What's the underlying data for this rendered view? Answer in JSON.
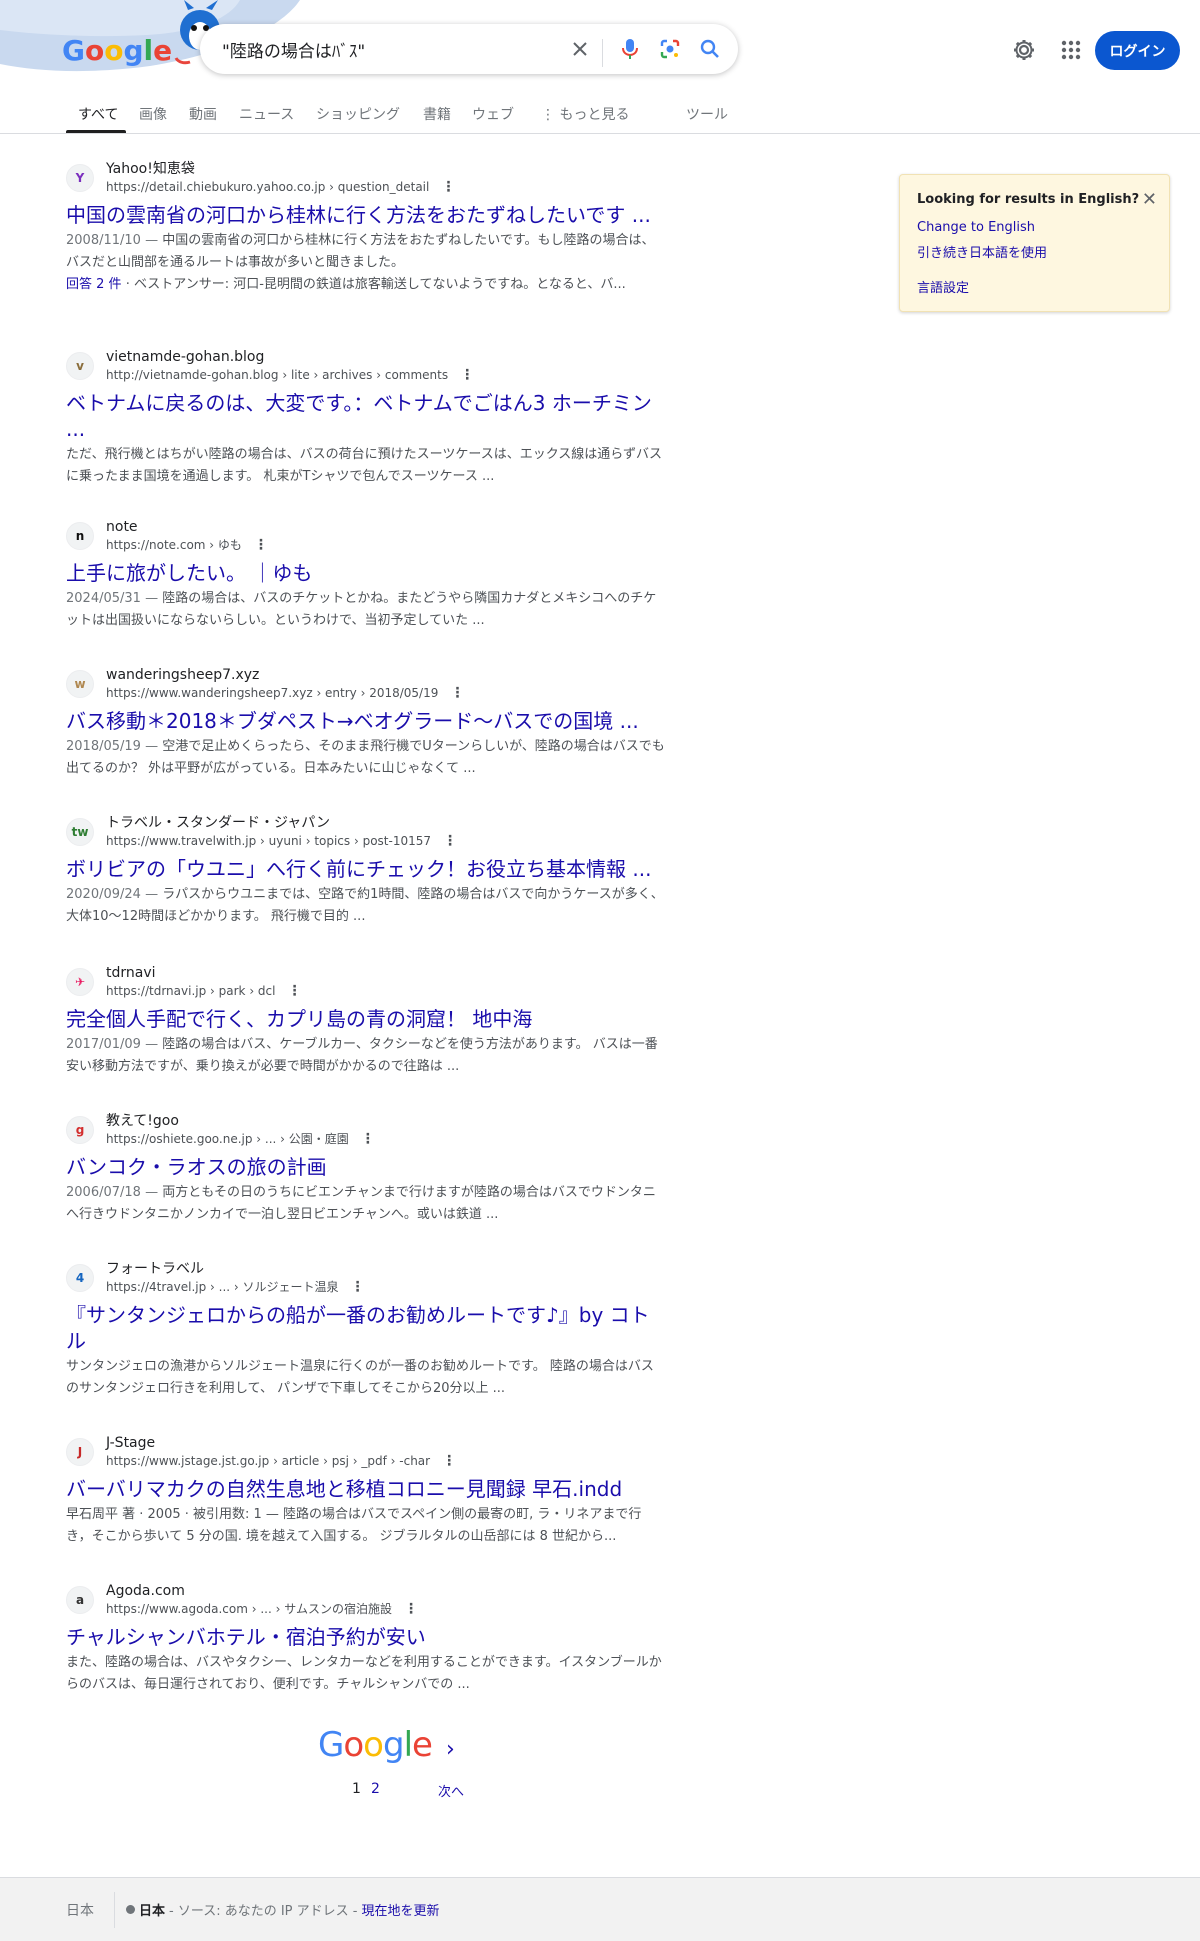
{
  "search": {
    "query": "\"陸路の場合はﾊﾞｽ\"",
    "login_label": "ログイン"
  },
  "tabs": [
    {
      "label": "すべて"
    },
    {
      "label": "画像"
    },
    {
      "label": "動画"
    },
    {
      "label": "ニュース"
    },
    {
      "label": "ショッピング"
    },
    {
      "label": "書籍"
    },
    {
      "label": "ウェブ"
    },
    {
      "label": "もっと見る"
    },
    {
      "label": "ツール"
    }
  ],
  "results": [
    {
      "site": "Yahoo!知恵袋",
      "url": "https://detail.chiebukuro.yahoo.co.jp › question_detail",
      "favicon": "Y",
      "favicon_color": "#7b2fbe",
      "title": "中国の雲南省の河口から桂林に行く方法をおたずねしたいです ...",
      "date": "2008/11/10",
      "snippet": "中国の雲南省の河口から桂林に行く方法をおたずねしたいです。もし陸路の場合は、バスだと山間部を通るルートは事故が多いと聞きました。",
      "extra_link": "回答 2 件",
      "extra_text": "· ベストアンサー: 河口-昆明間の鉄道は旅客輸送してないようですね。となると、バ..."
    },
    {
      "site": "vietnamde-gohan.blog",
      "url": "http://vietnamde-gohan.blog › lite › archives › comments",
      "favicon": "v",
      "favicon_color": "#8a6d3b",
      "title": "ベトナムに戻るのは、大変です。：ベトナムでごはん3 ホーチミン ...",
      "date": "",
      "snippet": "ただ、飛行機とはちがい陸路の場合は、バスの荷台に預けたスーツケースは、エックス線は通らずバスに乗ったまま国境を通過します。 札束がTシャツで包んでスーツケース ..."
    },
    {
      "site": "note",
      "url": "https://note.com › ゆも",
      "favicon": "n",
      "favicon_color": "#111111",
      "title": "上手に旅がしたい。 ｜ゆも",
      "date": "2024/05/31",
      "snippet": "陸路の場合は、バスのチケットとかね。またどうやら隣国カナダとメキシコへのチケットは出国扱いにならないらしい。というわけで、当初予定していた ..."
    },
    {
      "site": "wanderingsheep7.xyz",
      "url": "https://www.wanderingsheep7.xyz › entry › 2018/05/19",
      "favicon": "w",
      "favicon_color": "#b08850",
      "title": "バス移動＊2018＊ブダペスト→ベオグラード～バスでの国境 ...",
      "date": "2018/05/19",
      "snippet": "空港で足止めくらったら、そのまま飛行機でUターンらしいが、陸路の場合はバスでも出てるのか？ 外は平野が広がっている。日本みたいに山じゃなくて ..."
    },
    {
      "site": "トラベル・スタンダード・ジャパン",
      "url": "https://www.travelwith.jp › uyuni › topics › post-10157",
      "favicon": "tw",
      "favicon_color": "#2e7d32",
      "title": "ボリビアの「ウユニ」へ行く前にチェック！お役立ち基本情報 ...",
      "date": "2020/09/24",
      "snippet": "ラパスからウユニまでは、空路で約1時間、陸路の場合はバスで向かうケースが多く、大体10〜12時間ほどかかります。 飛行機で目的 ..."
    },
    {
      "site": "tdrnavi",
      "url": "https://tdrnavi.jp › park › dcl",
      "favicon": "✈",
      "favicon_color": "#e91e63",
      "title": "完全個人手配で行く、カプリ島の青の洞窟！ 地中海",
      "date": "2017/01/09",
      "snippet": "陸路の場合はバス、ケーブルカー、タクシーなどを使う方法があります。 バスは一番安い移動方法ですが、乗り換えが必要で時間がかかるので往路は ..."
    },
    {
      "site": "教えて!goo",
      "url": "https://oshiete.goo.ne.jp › ... › 公園・庭園",
      "favicon": "g",
      "favicon_color": "#d32f2f",
      "title": "バンコク・ラオスの旅の計画",
      "date": "2006/07/18",
      "snippet": "両方ともその日のうちにビエンチャンまで行けますが陸路の場合はバスでウドンタニへ行きウドンタニかノンカイで一泊し翌日ビエンチャンへ。或いは鉄道 ..."
    },
    {
      "site": "フォートラベル",
      "url": "https://4travel.jp › ... › ソルジェート温泉",
      "favicon": "4",
      "favicon_color": "#1565c0",
      "title": "『サンタンジェロからの船が一番のお勧めルートです♪』by コトル",
      "date": "",
      "snippet": "サンタンジェロの漁港からソルジェート温泉に行くのが一番のお勧めルートです。 陸路の場合はバスのサンタンジェロ行きを利用して、 パンザで下車してそこから20分以上 ..."
    },
    {
      "site": "J-Stage",
      "url": "https://www.jstage.jst.go.jp › article › psj › _pdf › -char",
      "favicon": "J",
      "favicon_color": "#c62828",
      "title": "バーバリマカクの自然生息地と移植コロニー見聞録 早石.indd",
      "date": "",
      "snippet": "早石周平 著 · 2005 · 被引用数: 1 — 陸路の場合はバスでスペイン側の最寄の町, ラ・リネアまで行き，そこから歩いて 5 分の国. 境を越えて入国する。 ジブラルタルの山岳部には 8 世紀から..."
    },
    {
      "site": "Agoda.com",
      "url": "https://www.agoda.com › ... › サムスンの宿泊施設",
      "favicon": "a",
      "favicon_color": "#333333",
      "title": "チャルシャンバホテル・宿泊予約が安い",
      "date": "",
      "snippet": "また、陸路の場合は、バスやタクシー、レンタカーなどを利用することができます。イスタンブールからのバスは、毎日運行されており、便利です。チャルシャンバでの ..."
    }
  ],
  "lang_panel": {
    "title": "Looking for results in English?",
    "change": "Change to English",
    "continue": "引き続き日本語を使用",
    "settings": "言語設定"
  },
  "pager": {
    "logo": "Google",
    "page1": "1",
    "page2": "2",
    "next": "次へ"
  },
  "footer": {
    "country": "日本",
    "location": "日本",
    "source": "- ソース: あなたの IP アドレス -",
    "update": "現在地を更新"
  },
  "colors": {
    "link": "#1a0dab",
    "login": "#0b57d0",
    "panel_bg": "#fef7e0"
  }
}
